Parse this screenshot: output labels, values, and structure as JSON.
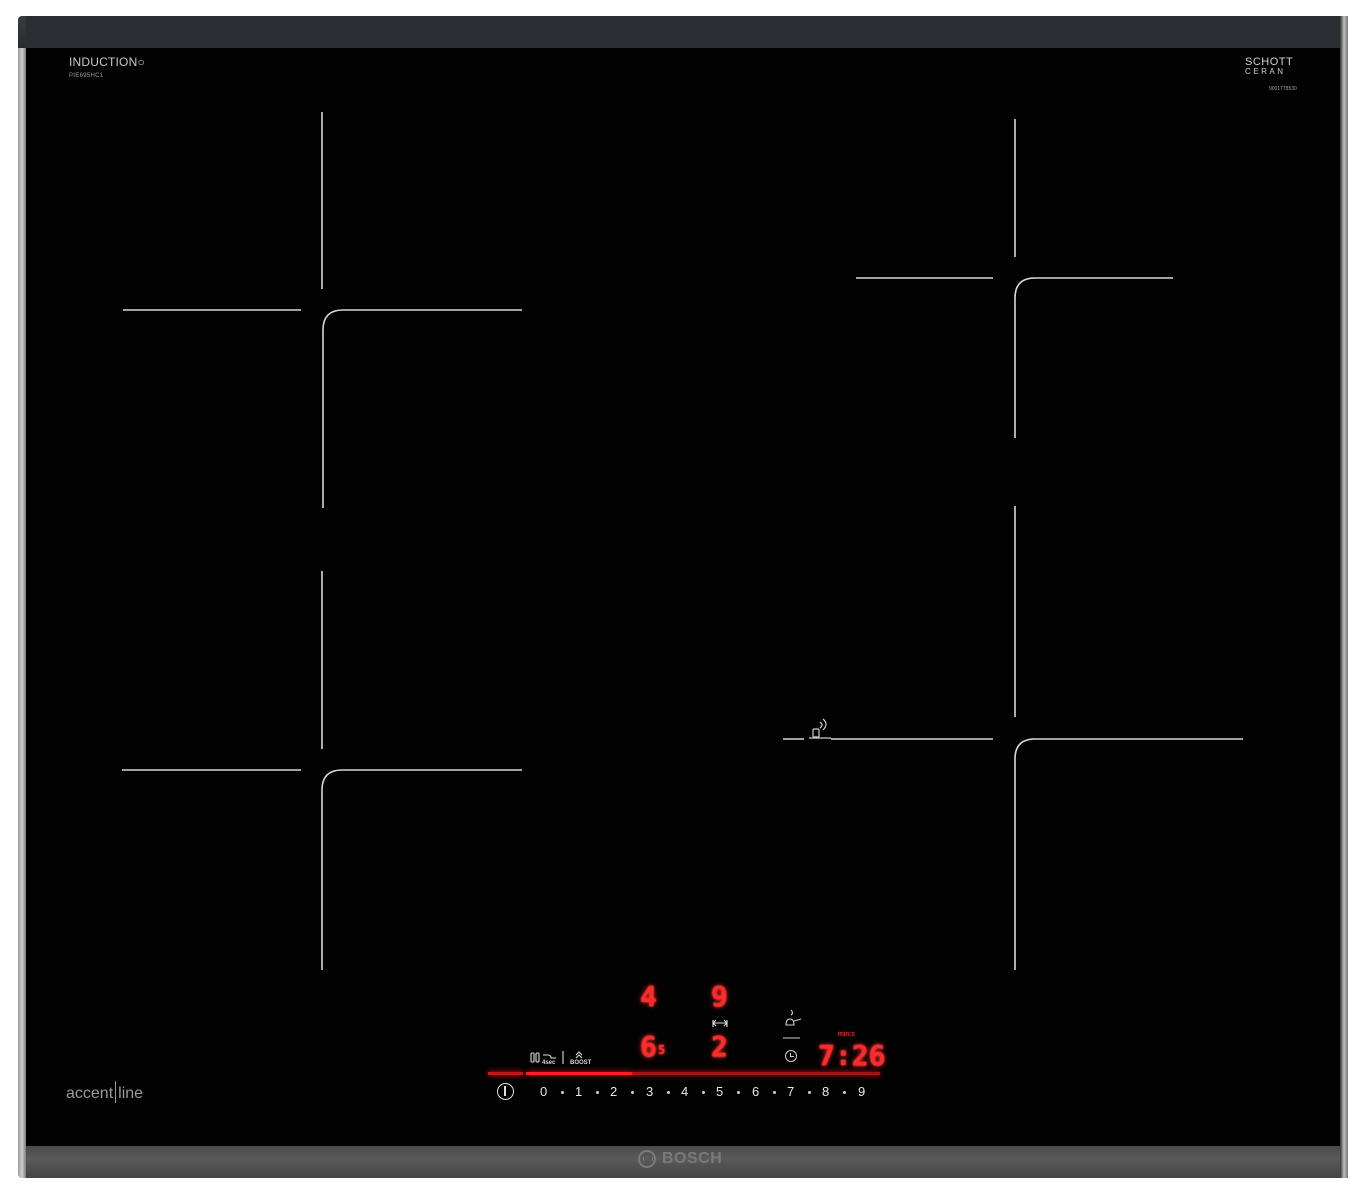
{
  "brand": {
    "induction_label": "INDUCTION",
    "model": "PIE695HC1",
    "schott_line1": "SCHOTT",
    "schott_line2": "CERAN",
    "serial": "9001778530",
    "accent": "accent",
    "accent_line": "line",
    "bosch": "BOSCH"
  },
  "display": {
    "zone_left_top": "4",
    "zone_right_top": "9",
    "zone_left_bottom": "6",
    "zone_left_bottom_sub": "5",
    "zone_right_bottom": "2",
    "timer": "7:26",
    "timer_unit": "min:s",
    "sec_label": "4sec",
    "boost_label": "BOOST"
  },
  "slider": {
    "labels": [
      "0",
      "1",
      "2",
      "3",
      "4",
      "5",
      "6",
      "7",
      "8",
      "9"
    ]
  },
  "colors": {
    "glass": "#020203",
    "display_red": "#ff2a2a",
    "frame": "#2c2d32"
  }
}
